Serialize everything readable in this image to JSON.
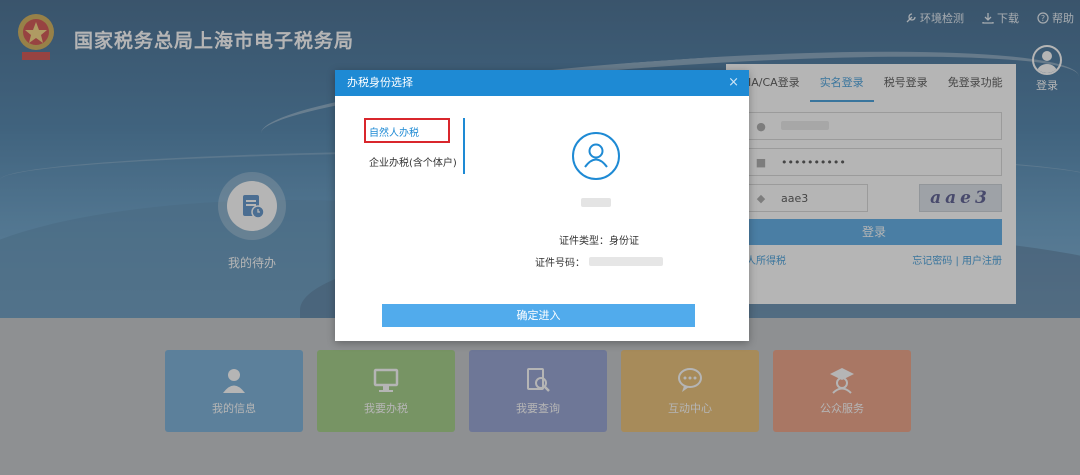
{
  "header": {
    "site_title": "国家税务总局上海市电子税务局",
    "links": [
      {
        "label": "环境检测",
        "icon": "wrench-icon"
      },
      {
        "label": "下载",
        "icon": "download-icon"
      },
      {
        "label": "帮助",
        "icon": "help-icon"
      }
    ],
    "login_label": "登录"
  },
  "todo": {
    "label": "我的待办"
  },
  "login_panel": {
    "tabs": [
      "IA/CA登录",
      "实名登录",
      "税号登录",
      "免登录功能"
    ],
    "active_tab": 1,
    "password_value": "••••••••••",
    "code_value": "aae3",
    "captcha_text": "aae3",
    "login_button": "登录",
    "link_left": "人所得税",
    "link_right": "忘记密码 | 用户注册"
  },
  "tiles": [
    {
      "label": "我的信息",
      "color": "#5d9fcf",
      "icon": "person-icon"
    },
    {
      "label": "我要办税",
      "color": "#8fc36c",
      "icon": "monitor-icon"
    },
    {
      "label": "我要查询",
      "color": "#7f8ec9",
      "icon": "search-doc-icon"
    },
    {
      "label": "互动中心",
      "color": "#e6b35a",
      "icon": "chat-icon"
    },
    {
      "label": "公众服务",
      "color": "#e98e6c",
      "icon": "graduate-icon"
    }
  ],
  "modal": {
    "title": "办税身份选择",
    "close": "×",
    "options": [
      "自然人办税",
      "企业办税(含个体户)"
    ],
    "selected_option": 0,
    "id_type_label": "证件类型：身份证",
    "id_number_label": "证件号码：",
    "confirm_button": "确定进入"
  },
  "colors": {
    "accent": "#1e8ad4",
    "highlight": "#d9262c",
    "confirm": "#51abec"
  }
}
